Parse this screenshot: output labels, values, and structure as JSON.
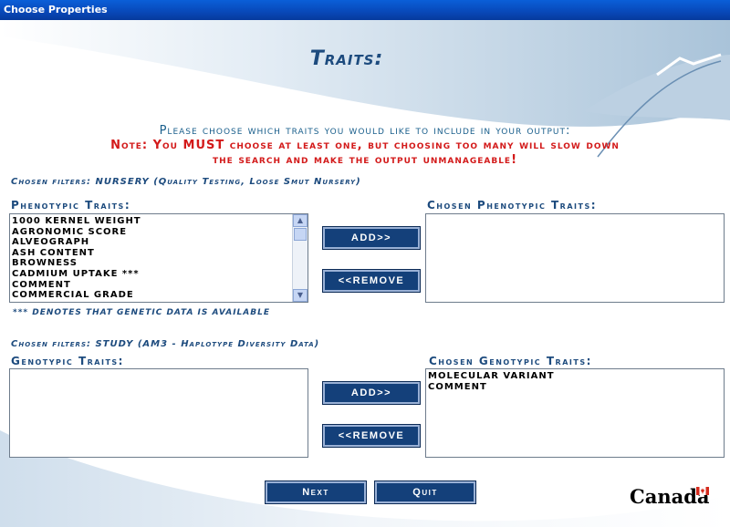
{
  "window": {
    "title": "Choose Properties"
  },
  "heading": "Traits:",
  "prompt": "Please choose which traits you would like to include in your output:",
  "note_line1": "Note:  You MUST choose at least one, but choosing too many will slow down",
  "note_line2": "the search and make the output unmanageable!",
  "phenotypic": {
    "filter": "Chosen filters: NURSERY (Quality Testing, Loose Smut Nursery)",
    "label": "Phenotypic Traits:",
    "items": [
      "1000 Kernel Weight",
      "Agronomic Score",
      "Alveograph",
      "Ash Content",
      "Browness",
      "Cadmium Uptake ***",
      "Comment",
      "Commercial Grade"
    ],
    "chosen_label": "Chosen Phenotypic Traits:",
    "chosen_items": [],
    "add_label": "ADD>>",
    "remove_label": "<<REMOVE",
    "footnote": "*** denotes that genetic data is available"
  },
  "genotypic": {
    "filter": "Chosen filters: STUDY (AM3 - Haplotype Diversity Data)",
    "label": "Genotypic Traits:",
    "items": [],
    "chosen_label": "Chosen Genotypic Traits:",
    "chosen_items": [
      "Molecular Variant",
      "Comment"
    ],
    "add_label": "ADD>>",
    "remove_label": "<<REMOVE"
  },
  "buttons": {
    "next": "Next",
    "quit": "Quit"
  },
  "logo_text": "Canada",
  "colors": {
    "title_bar": "#0a5fd8",
    "heading": "#1d4b7e",
    "prompt": "#1a5f8c",
    "warning": "#d31a1a",
    "button": "#14407a"
  }
}
